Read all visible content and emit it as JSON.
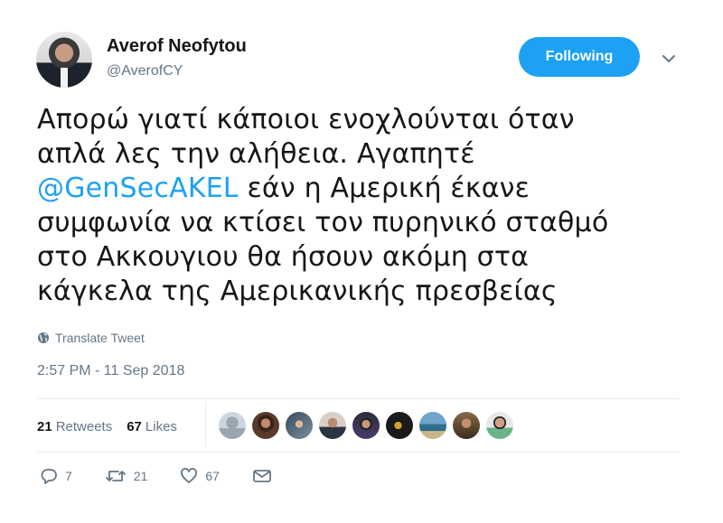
{
  "author": {
    "name": "Averof Neofytou",
    "handle": "@AverofCY"
  },
  "follow_button": {
    "label": "Following",
    "color": "#1da1f2"
  },
  "tweet": {
    "lines": [
      "Απορώ γιατί κάποιοι ενοχλούνται όταν",
      "απλά λες την αλήθεια. Αγαπητέ",
      {
        "mention": "@GenSecAKEL",
        "rest": " εάν η Αμερική έκανε"
      },
      "συμφωνία να κτίσει τον πυρηνικό σταθμό",
      "στο Ακκουγιου θα ήσουν ακόμη στα",
      "κάγκελα της Αμερικανικής πρεσβείας"
    ]
  },
  "translate_label": "Translate Tweet",
  "timestamp": "2:57 PM - 11 Sep 2018",
  "stats": {
    "retweets_count": "21",
    "retweets_label": "Retweets",
    "likes_count": "67",
    "likes_label": "Likes"
  },
  "likers_count_shown": 9,
  "actions": {
    "reply_count": "7",
    "retweet_count": "21",
    "like_count": "67"
  },
  "icons": [
    "chevron-down-icon",
    "globe-icon",
    "reply-icon",
    "retweet-icon",
    "heart-icon",
    "message-icon"
  ]
}
